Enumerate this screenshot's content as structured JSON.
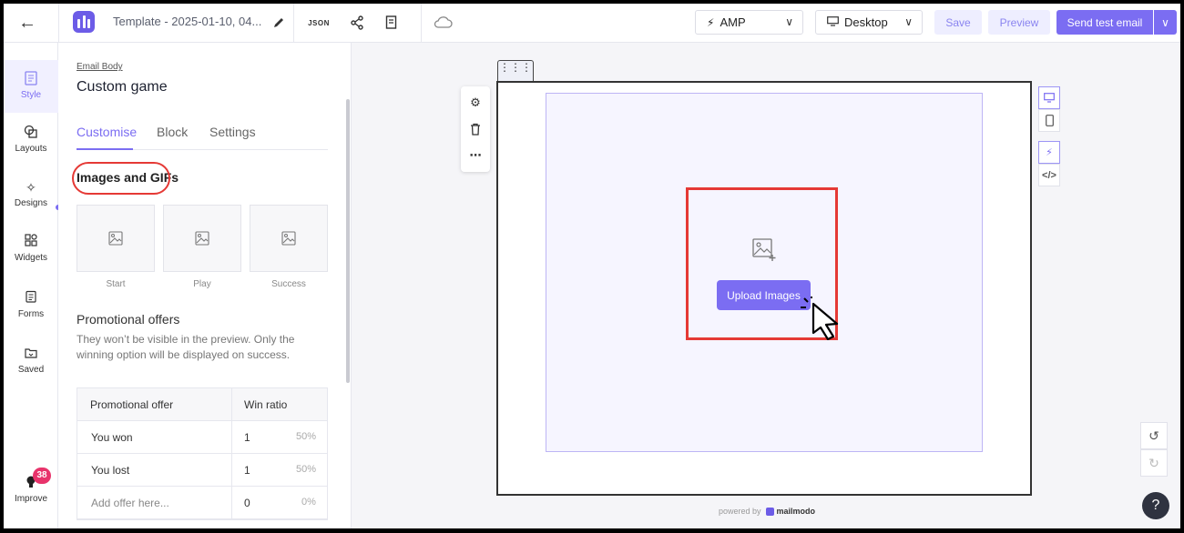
{
  "header": {
    "back_icon": "arrow-left-icon",
    "template_title": "Template - 2025-01-10, 04...",
    "json_label": "JSON",
    "amp_label": "AMP",
    "desktop_label": "Desktop",
    "save_label": "Save",
    "preview_label": "Preview",
    "send_test_label": "Send test email",
    "accent_color": "#7b6df2"
  },
  "rail": {
    "items": [
      {
        "label": "Style",
        "icon": "style-icon"
      },
      {
        "label": "Layouts",
        "icon": "layouts-icon"
      },
      {
        "label": "Designs",
        "icon": "designs-icon"
      },
      {
        "label": "Widgets",
        "icon": "widgets-icon"
      },
      {
        "label": "Forms",
        "icon": "forms-icon"
      },
      {
        "label": "Saved",
        "icon": "saved-icon"
      }
    ],
    "improve_label": "Improve",
    "improve_count": "38"
  },
  "panel": {
    "breadcrumb": "Email Body",
    "title": "Custom game",
    "tabs": [
      "Customise",
      "Block",
      "Settings"
    ],
    "images_heading": "Images and GIFs",
    "image_slots": [
      "Start",
      "Play",
      "Success"
    ],
    "promo_heading": "Promotional offers",
    "promo_desc": "They won’t be visible in the preview. Only the winning option will be displayed on success.",
    "table": {
      "headers": [
        "Promotional offer",
        "Win ratio"
      ],
      "rows": [
        {
          "offer": "You won",
          "ratio": "1",
          "pct": "50%"
        },
        {
          "offer": "You lost",
          "ratio": "1",
          "pct": "50%"
        },
        {
          "offer": "Add offer here...",
          "ratio": "0",
          "pct": "0%"
        }
      ]
    }
  },
  "canvas": {
    "upload_label": "Upload Images",
    "powered_by": "powered by",
    "brand": "mailmodo",
    "help_label": "?"
  }
}
